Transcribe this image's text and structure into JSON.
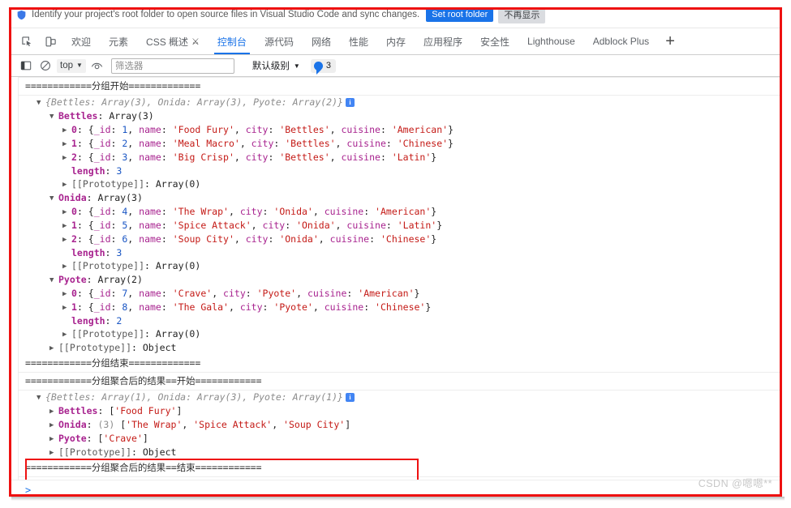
{
  "banner": {
    "icon": "shield-icon",
    "text": "Identify your project's root folder to open source files in Visual Studio Code and sync changes.",
    "primary_button": "Set root folder",
    "secondary_button": "不再显示"
  },
  "tabbar": {
    "inspect_icon": "inspect-element-icon",
    "device_icon": "device-toolbar-icon",
    "add_icon": "add-panel-icon",
    "tabs": [
      {
        "label": "欢迎",
        "active": false
      },
      {
        "label": "元素",
        "active": false
      },
      {
        "label": "CSS 概述",
        "active": false,
        "trailing_icon": "flask-icon"
      },
      {
        "label": "控制台",
        "active": true
      },
      {
        "label": "源代码",
        "active": false
      },
      {
        "label": "网络",
        "active": false
      },
      {
        "label": "性能",
        "active": false
      },
      {
        "label": "内存",
        "active": false
      },
      {
        "label": "应用程序",
        "active": false
      },
      {
        "label": "安全性",
        "active": false
      },
      {
        "label": "Lighthouse",
        "active": false
      },
      {
        "label": "Adblock Plus",
        "active": false
      }
    ]
  },
  "filterbar": {
    "sidebar_icon": "console-sidebar-icon",
    "clear_icon": "clear-console-icon",
    "context_select": "top",
    "eye_icon": "live-expression-icon",
    "filter_placeholder": "筛选器",
    "level_select": "默认级别",
    "message_count": "3"
  },
  "console": {
    "accent_color": "#1a73e8",
    "highlight_color": "#ee1111",
    "rows": [
      {
        "type": "separator",
        "text": "============分组开始============="
      },
      {
        "type": "object_header",
        "triangle": "open",
        "indent": 1,
        "preview": "{Bettles: Array(3), Onida: Array(3), Pyote: Array(2)}",
        "info_icon": "info-icon"
      },
      {
        "type": "prop_header",
        "triangle": "open",
        "indent": 2,
        "prop": "Bettles",
        "value": "Array(3)"
      },
      {
        "type": "entry",
        "triangle": "closed",
        "indent": 3,
        "index": "0",
        "_id": "1",
        "name": "Food Fury",
        "city": "Bettles",
        "cuisine": "American"
      },
      {
        "type": "entry",
        "triangle": "closed",
        "indent": 3,
        "index": "1",
        "_id": "2",
        "name": "Meal Macro",
        "city": "Bettles",
        "cuisine": "Chinese"
      },
      {
        "type": "entry",
        "triangle": "closed",
        "indent": 3,
        "index": "2",
        "_id": "3",
        "name": "Big Crisp",
        "city": "Bettles",
        "cuisine": "Latin"
      },
      {
        "type": "length",
        "indent": 3,
        "label": "length",
        "value": "3"
      },
      {
        "type": "proto",
        "triangle": "closed",
        "indent": 3,
        "label": "[[Prototype]]",
        "value": "Array(0)"
      },
      {
        "type": "prop_header",
        "triangle": "open",
        "indent": 2,
        "prop": "Onida",
        "value": "Array(3)"
      },
      {
        "type": "entry",
        "triangle": "closed",
        "indent": 3,
        "index": "0",
        "_id": "4",
        "name": "The Wrap",
        "city": "Onida",
        "cuisine": "American"
      },
      {
        "type": "entry",
        "triangle": "closed",
        "indent": 3,
        "index": "1",
        "_id": "5",
        "name": "Spice Attack",
        "city": "Onida",
        "cuisine": "Latin"
      },
      {
        "type": "entry",
        "triangle": "closed",
        "indent": 3,
        "index": "2",
        "_id": "6",
        "name": "Soup City",
        "city": "Onida",
        "cuisine": "Chinese"
      },
      {
        "type": "length",
        "indent": 3,
        "label": "length",
        "value": "3"
      },
      {
        "type": "proto",
        "triangle": "closed",
        "indent": 3,
        "label": "[[Prototype]]",
        "value": "Array(0)"
      },
      {
        "type": "prop_header",
        "triangle": "open",
        "indent": 2,
        "prop": "Pyote",
        "value": "Array(2)"
      },
      {
        "type": "entry",
        "triangle": "closed",
        "indent": 3,
        "index": "0",
        "_id": "7",
        "name": "Crave",
        "city": "Pyote",
        "cuisine": "American"
      },
      {
        "type": "entry",
        "triangle": "closed",
        "indent": 3,
        "index": "1",
        "_id": "8",
        "name": "The Gala",
        "city": "Pyote",
        "cuisine": "Chinese"
      },
      {
        "type": "length",
        "indent": 3,
        "label": "length",
        "value": "2"
      },
      {
        "type": "proto",
        "triangle": "closed",
        "indent": 3,
        "label": "[[Prototype]]",
        "value": "Array(0)"
      },
      {
        "type": "proto",
        "triangle": "closed",
        "indent": 2,
        "label": "[[Prototype]]",
        "value": "Object"
      },
      {
        "type": "separator",
        "text": "============分组结束============="
      },
      {
        "type": "separator",
        "text": "============分组聚合后的结果==开始============"
      },
      {
        "type": "object_header",
        "triangle": "open",
        "indent": 1,
        "preview": "{Bettles: Array(1), Onida: Array(3), Pyote: Array(1)}",
        "info_icon": "info-icon"
      },
      {
        "type": "array_prop",
        "triangle": "closed",
        "indent": 2,
        "prop": "Bettles",
        "count": "",
        "items": [
          "Food Fury"
        ]
      },
      {
        "type": "array_prop",
        "triangle": "closed",
        "indent": 2,
        "prop": "Onida",
        "count": "(3)",
        "items": [
          "The Wrap",
          "Spice Attack",
          "Soup City"
        ]
      },
      {
        "type": "array_prop",
        "triangle": "closed",
        "indent": 2,
        "prop": "Pyote",
        "count": "",
        "items": [
          "Crave"
        ]
      },
      {
        "type": "proto",
        "triangle": "closed",
        "indent": 2,
        "label": "[[Prototype]]",
        "value": "Object"
      },
      {
        "type": "separator",
        "text": "============分组聚合后的结果==结束============"
      }
    ]
  },
  "prompt": {
    "symbol": ">",
    "value": ""
  },
  "watermark": "CSDN @嗯嗯**"
}
